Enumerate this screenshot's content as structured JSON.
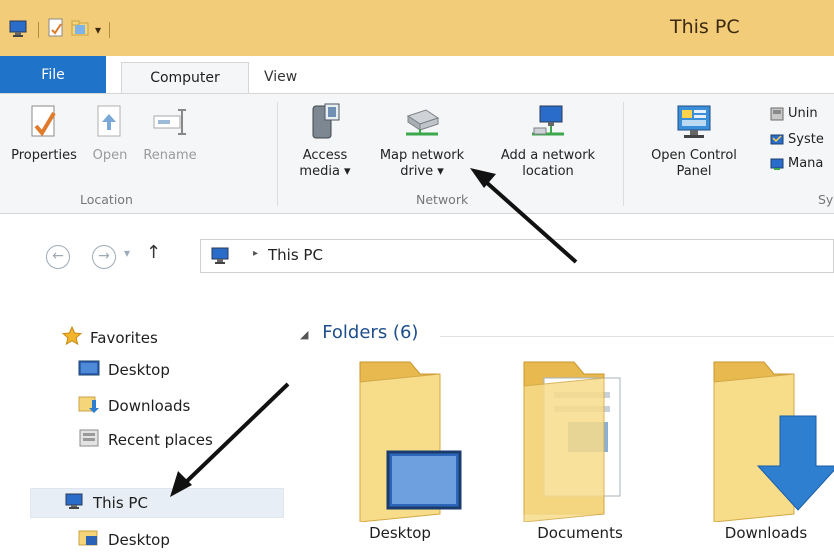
{
  "window": {
    "title": "This PC"
  },
  "tabs": [
    {
      "label": "File"
    },
    {
      "label": "Computer"
    },
    {
      "label": "View"
    }
  ],
  "ribbon": {
    "location": {
      "label": "Location",
      "buttons": [
        {
          "label": "Properties"
        },
        {
          "label": "Open"
        },
        {
          "label": "Rename"
        }
      ]
    },
    "network": {
      "label": "Network",
      "buttons": [
        {
          "line1": "Access",
          "line2": "media ▾"
        },
        {
          "line1": "Map network",
          "line2": "drive ▾"
        },
        {
          "line1": "Add a network",
          "line2": "location"
        }
      ]
    },
    "system": {
      "label": "Sy",
      "open_control_panel": {
        "line1": "Open Control",
        "line2": "Panel"
      },
      "small_items": [
        "Unin",
        "Syste",
        "Mana"
      ]
    }
  },
  "address": {
    "back": "←",
    "forward": "→",
    "up": "↑",
    "recent": "▾",
    "crumb_sep": "▸",
    "crumb": "This PC"
  },
  "nav": {
    "favorites": "Favorites",
    "items": [
      "Desktop",
      "Downloads",
      "Recent places"
    ],
    "this_pc": "This PC",
    "this_pc_children": [
      "Desktop"
    ]
  },
  "content": {
    "group": "Folders (6)",
    "folders": [
      "Desktop",
      "Documents",
      "Downloads"
    ]
  },
  "colors": {
    "titlebar": "#f3cc79",
    "file_tab": "#1f73c8",
    "ribbon_bg": "#f5f6f7",
    "folder": "#f5d57a"
  }
}
